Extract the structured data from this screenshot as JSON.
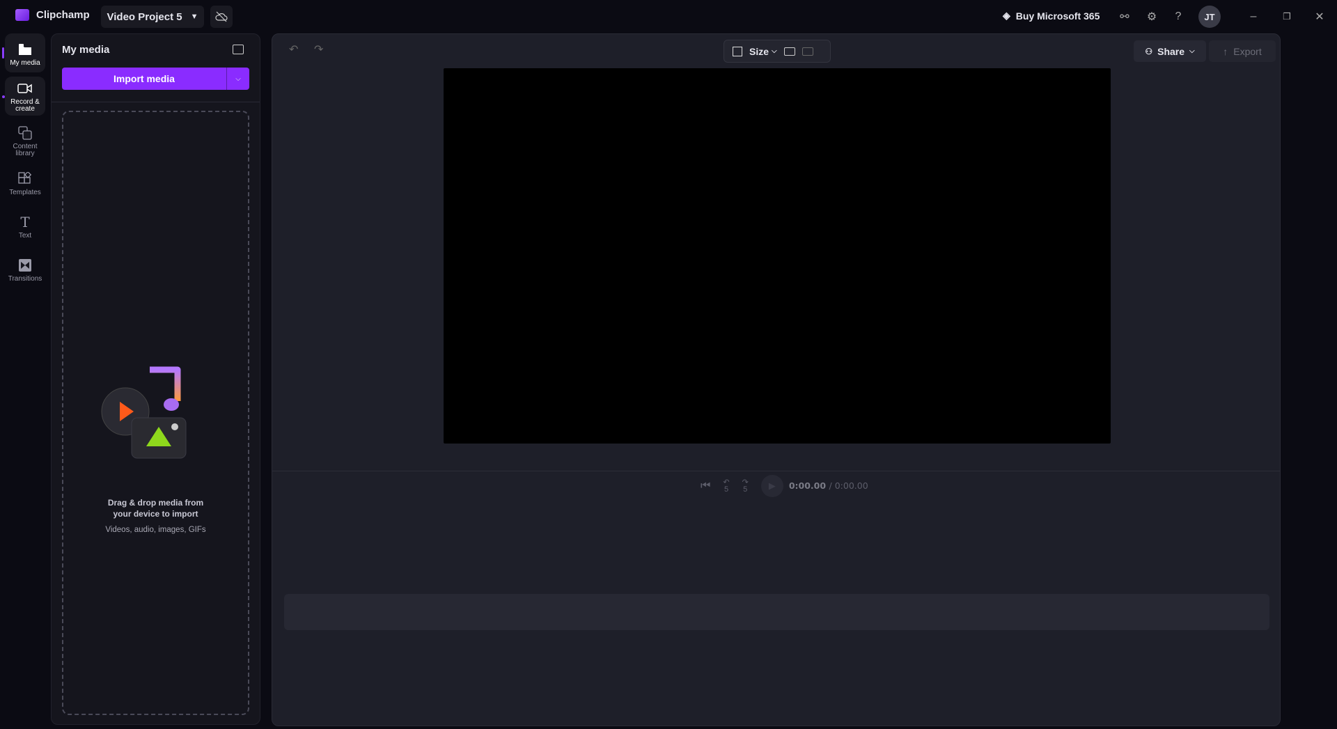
{
  "app": {
    "name": "Clipchamp",
    "project_title": "Video Project 5",
    "brand_color": "#8a2cff"
  },
  "topbar": {
    "buy_label": "Buy Microsoft 365",
    "avatar_initials": "JT",
    "icons": [
      "diamond-icon",
      "connect-icon",
      "gear-icon",
      "help-icon",
      "minimize-icon",
      "restore-icon",
      "close-icon"
    ]
  },
  "rail": {
    "items": [
      {
        "label": "My media",
        "icon": "folder-icon",
        "active": true
      },
      {
        "label": "Record & create",
        "icon": "camera-icon"
      },
      {
        "label": "Content library",
        "icon": "library-icon"
      },
      {
        "label": "Templates",
        "icon": "templates-icon"
      },
      {
        "label": "Text",
        "icon": "text-icon"
      },
      {
        "label": "Transitions",
        "icon": "transitions-icon"
      }
    ]
  },
  "media_panel": {
    "title": "My media",
    "import_label": "Import media",
    "drop_title": "Drag & drop media from your device to import",
    "drop_subtitle": "Videos, audio, images, GIFs"
  },
  "editor": {
    "size_label": "Size",
    "share_label": "Share",
    "export_label": "Export",
    "time_current": "0:00.00",
    "time_total": "/ 0:00.00",
    "skip_seconds": "5"
  }
}
